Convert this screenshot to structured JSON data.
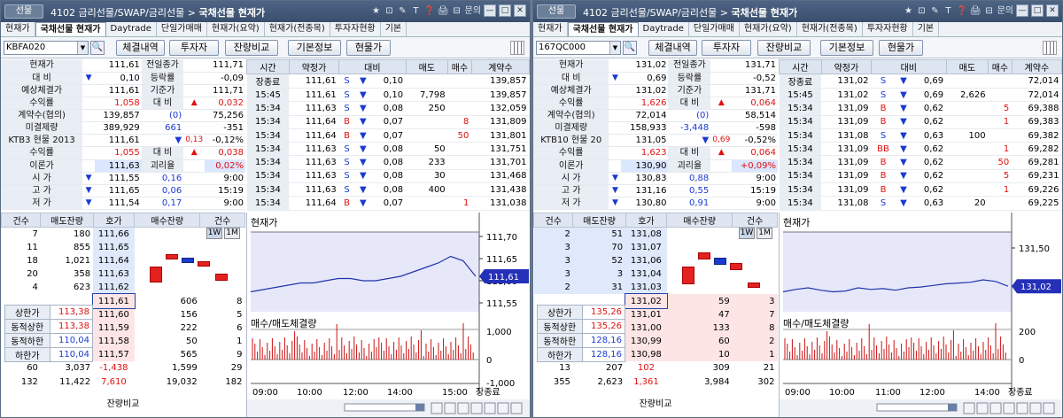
{
  "windows": [
    {
      "logo": "선물",
      "title_path": "4102 금리선물/SWAP/금리선물",
      "title_bold": "국채선물 현재가",
      "title_icons": [
        "★",
        "⊡",
        "✎",
        "T",
        "❓",
        "🖨",
        "⊟",
        "문의",
        "—",
        "□",
        "✕"
      ],
      "tabs": [
        "현재가",
        "국채선물 현재가",
        "Daytrade",
        "단일가매매",
        "현재가(요약)",
        "현재가(전종목)",
        "투자자현황",
        "기본"
      ],
      "active_tab": 1,
      "code": "KBFA020",
      "buttons": [
        "체결내역",
        "투자자",
        "잔량비교",
        "기본정보",
        "현물가"
      ],
      "info_rows": [
        [
          "현재가",
          "",
          "111,61",
          "전일종가",
          "",
          "111,71"
        ],
        [
          "대 비",
          "▼",
          "0,10",
          "등락률",
          "",
          "-0,09"
        ],
        [
          "예상체결가",
          "",
          "111,61",
          "기준가",
          "",
          "111,71"
        ],
        [
          "수익률",
          "",
          "1,058",
          "대 비",
          "▲",
          "0,032"
        ],
        [
          "계약수(협의)",
          "",
          "139,857",
          "(0)",
          "",
          "75,256"
        ],
        [
          "미결제량",
          "",
          "389,929",
          "661",
          "",
          "-351"
        ],
        [
          "KTB3 현물 2013",
          "",
          "111,61",
          "▼",
          "0,13",
          "-0,12%"
        ],
        [
          "수익률",
          "",
          "1,055",
          "대 비",
          "▲",
          "0,038"
        ],
        [
          "이론가",
          "",
          "111,63",
          "괴리율",
          "",
          "0,02%"
        ],
        [
          "시 가",
          "▼",
          "111,55",
          "0,16",
          "",
          "9:00"
        ],
        [
          "고 가",
          "▼",
          "111,65",
          "0,06",
          "",
          "15:19"
        ],
        [
          "저 가",
          "▼",
          "111,54",
          "0,17",
          "",
          "9:00"
        ]
      ],
      "tick_headers": [
        "시간",
        "약정가",
        "대비",
        "매도",
        "매수",
        "계약수"
      ],
      "ticks": [
        [
          "장종료",
          "111,61",
          "S",
          "▼",
          "0,10",
          "",
          "",
          "139,857"
        ],
        [
          "15:45",
          "111,61",
          "S",
          "▼",
          "0,10",
          "7,798",
          "",
          "139,857"
        ],
        [
          "15:34",
          "111,63",
          "S",
          "▼",
          "0,08",
          "250",
          "",
          "132,059"
        ],
        [
          "15:34",
          "111,64",
          "B",
          "▼",
          "0,07",
          "",
          "8",
          "131,809"
        ],
        [
          "15:34",
          "111,64",
          "B",
          "▼",
          "0,07",
          "",
          "50",
          "131,801"
        ],
        [
          "15:34",
          "111,63",
          "S",
          "▼",
          "0,08",
          "50",
          "",
          "131,751"
        ],
        [
          "15:34",
          "111,63",
          "S",
          "▼",
          "0,08",
          "233",
          "",
          "131,701"
        ],
        [
          "15:34",
          "111,63",
          "S",
          "▼",
          "0,08",
          "30",
          "",
          "131,468"
        ],
        [
          "15:34",
          "111,63",
          "S",
          "▼",
          "0,08",
          "400",
          "",
          "131,438"
        ],
        [
          "15:34",
          "111,64",
          "B",
          "▼",
          "0,07",
          "",
          "1",
          "131,038"
        ]
      ],
      "ob_headers": [
        "건수",
        "매도잔량",
        "호가",
        "매수잔량",
        "건수"
      ],
      "asks": [
        [
          "7",
          "180",
          "111,66"
        ],
        [
          "11",
          "855",
          "111,65"
        ],
        [
          "18",
          "1,021",
          "111,64"
        ],
        [
          "20",
          "358",
          "111,63"
        ],
        [
          "4",
          "623",
          "111,62"
        ]
      ],
      "bids": [
        [
          "111,61",
          "606",
          "8"
        ],
        [
          "111,60",
          "156",
          "5"
        ],
        [
          "111,59",
          "222",
          "6"
        ],
        [
          "111,58",
          "50",
          "1"
        ],
        [
          "111,57",
          "565",
          "9"
        ]
      ],
      "limits": [
        [
          "상한가",
          "113,38"
        ],
        [
          "동적상한",
          "113,38"
        ],
        [
          "동적하한",
          "110,04"
        ],
        [
          "하한가",
          "110,04"
        ]
      ],
      "totals1": [
        "60",
        "3,037",
        "-1,438",
        "1,599",
        "29"
      ],
      "totals2": [
        "132",
        "11,422",
        "7,610",
        "19,032",
        "182"
      ],
      "ob_footer": "잔량비교",
      "chart_data": {
        "type": "line",
        "title": "현재가",
        "current": "111,61",
        "yticks": [
          "111,70",
          "111,65",
          "111,60",
          "111,55"
        ],
        "ylim": [
          111.53,
          111.71
        ],
        "x": [
          "09:00",
          "10:00",
          "12:00",
          "14:00",
          "15:00",
          "장종료"
        ],
        "values": [
          111.575,
          111.58,
          111.585,
          111.59,
          111.595,
          111.595,
          111.6,
          111.605,
          111.605,
          111.6,
          111.6,
          111.605,
          111.61,
          111.62,
          111.63,
          111.64,
          111.655,
          111.645,
          111.61
        ],
        "vol_title": "매수/매도체결량",
        "vol_yticks": [
          "1,000",
          "0",
          "-1,000"
        ]
      },
      "candle_tabs": [
        "1W",
        "1M"
      ]
    },
    {
      "logo": "선물",
      "title_path": "4102 금리선물/SWAP/금리선물",
      "title_bold": "국채선물 현재가",
      "title_icons": [
        "★",
        "⊡",
        "✎",
        "T",
        "❓",
        "🖨",
        "⊟",
        "문의",
        "—",
        "□",
        "✕"
      ],
      "tabs": [
        "현재가",
        "국채선물 현재가",
        "Daytrade",
        "단일가매매",
        "현재가(요약)",
        "현재가(전종목)",
        "투자자현황",
        "기본"
      ],
      "active_tab": 1,
      "code": "167QC000",
      "buttons": [
        "체결내역",
        "투자자",
        "잔량비교",
        "기본정보",
        "현물가"
      ],
      "info_rows": [
        [
          "현재가",
          "",
          "131,02",
          "전일종가",
          "",
          "131,71"
        ],
        [
          "대 비",
          "▼",
          "0,69",
          "등락률",
          "",
          "-0,52"
        ],
        [
          "예상체결가",
          "",
          "131,02",
          "기준가",
          "",
          "131,71"
        ],
        [
          "수익률",
          "",
          "1,626",
          "대 비",
          "▲",
          "0,064"
        ],
        [
          "계약수(협의)",
          "",
          "72,014",
          "(0)",
          "",
          "58,514"
        ],
        [
          "미결제량",
          "",
          "158,933",
          "-3,448",
          "",
          "-598"
        ],
        [
          "KTB10 현물 20",
          "",
          "131,05",
          "▼",
          "0,69",
          "-0,52%"
        ],
        [
          "수익률",
          "",
          "1,623",
          "대 비",
          "▲",
          "0,064"
        ],
        [
          "이론가",
          "",
          "130,90",
          "괴리율",
          "",
          "+0,09%"
        ],
        [
          "시 가",
          "▼",
          "130,83",
          "0,88",
          "",
          "9:00"
        ],
        [
          "고 가",
          "▼",
          "131,16",
          "0,55",
          "",
          "15:19"
        ],
        [
          "저 가",
          "▼",
          "130,80",
          "0,91",
          "",
          "9:00"
        ]
      ],
      "tick_headers": [
        "시간",
        "약정가",
        "대비",
        "매도",
        "매수",
        "계약수"
      ],
      "ticks": [
        [
          "장종료",
          "131,02",
          "S",
          "▼",
          "0,69",
          "",
          "",
          "72,014"
        ],
        [
          "15:45",
          "131,02",
          "S",
          "▼",
          "0,69",
          "2,626",
          "",
          "72,014"
        ],
        [
          "15:34",
          "131,09",
          "B",
          "▼",
          "0,62",
          "",
          "5",
          "69,388"
        ],
        [
          "15:34",
          "131,09",
          "B",
          "▼",
          "0,62",
          "",
          "1",
          "69,383"
        ],
        [
          "15:34",
          "131,08",
          "S",
          "▼",
          "0,63",
          "100",
          "",
          "69,382"
        ],
        [
          "15:34",
          "131,09",
          "BB",
          "▼",
          "0,62",
          "",
          "1",
          "69,282"
        ],
        [
          "15:34",
          "131,09",
          "B",
          "▼",
          "0,62",
          "",
          "50",
          "69,281"
        ],
        [
          "15:34",
          "131,09",
          "B",
          "▼",
          "0,62",
          "",
          "5",
          "69,231"
        ],
        [
          "15:34",
          "131,09",
          "B",
          "▼",
          "0,62",
          "",
          "1",
          "69,226"
        ],
        [
          "15:34",
          "131,08",
          "S",
          "▼",
          "0,63",
          "20",
          "",
          "69,225"
        ]
      ],
      "ob_headers": [
        "건수",
        "매도잔량",
        "호가",
        "매수잔량",
        "건수"
      ],
      "asks": [
        [
          "2",
          "51",
          "131,08"
        ],
        [
          "3",
          "70",
          "131,07"
        ],
        [
          "3",
          "52",
          "131,06"
        ],
        [
          "3",
          "3",
          "131,04"
        ],
        [
          "2",
          "31",
          "131,03"
        ]
      ],
      "bids": [
        [
          "131,02",
          "59",
          "3"
        ],
        [
          "131,01",
          "47",
          "7"
        ],
        [
          "131,00",
          "133",
          "8"
        ],
        [
          "130,99",
          "60",
          "2"
        ],
        [
          "130,98",
          "10",
          "1"
        ]
      ],
      "limits": [
        [
          "상한가",
          "135,26"
        ],
        [
          "동적상한",
          "135,26"
        ],
        [
          "동적하한",
          "128,16"
        ],
        [
          "하한가",
          "128,16"
        ]
      ],
      "totals1": [
        "13",
        "207",
        "102",
        "309",
        "21"
      ],
      "totals2": [
        "355",
        "2,623",
        "1,361",
        "3,984",
        "302"
      ],
      "ob_footer": "잔량비교",
      "chart_data": {
        "type": "line",
        "title": "현재가",
        "current": "131,02",
        "yticks": [
          "131,50"
        ],
        "ylim": [
          130.7,
          131.7
        ],
        "x": [
          "09:00",
          "10:00",
          "11:00",
          "12:00",
          "14:00",
          "장종료"
        ],
        "values": [
          130.95,
          130.98,
          131.0,
          130.97,
          130.95,
          130.96,
          131.0,
          130.98,
          130.99,
          130.97,
          131.0,
          131.01,
          131.03,
          131.05,
          131.06,
          131.07,
          131.1,
          131.08,
          131.02
        ],
        "vol_title": "매수/매도체결량",
        "vol_yticks": [
          "200",
          "0"
        ]
      },
      "candle_tabs": [
        "1W",
        "1M"
      ]
    }
  ]
}
